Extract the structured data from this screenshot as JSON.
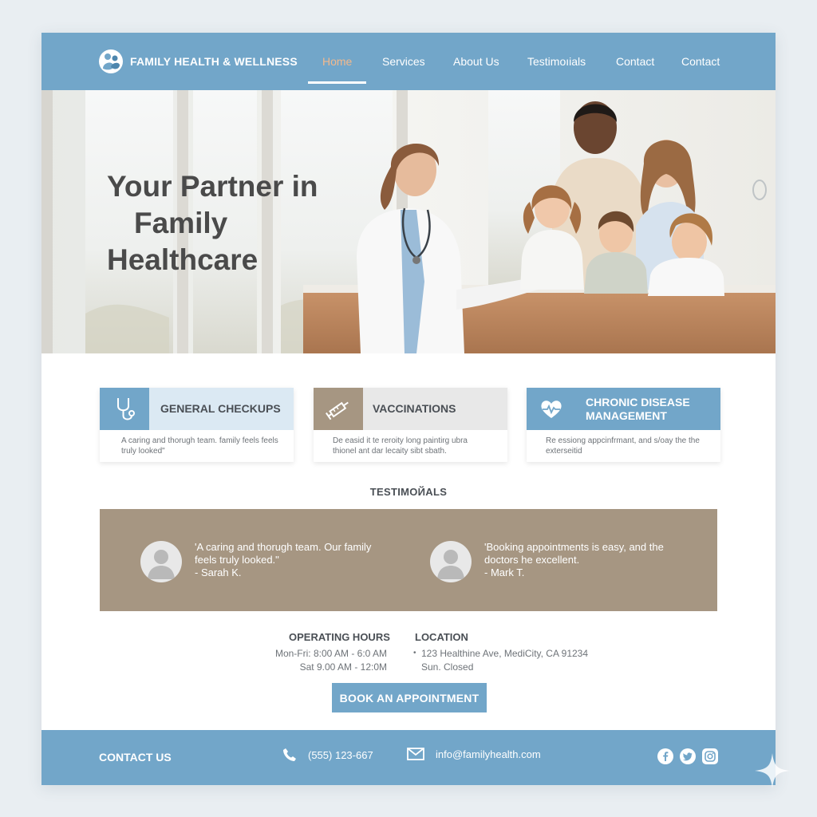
{
  "brand": {
    "name": "FAMILY HEALTH & WELLNESS",
    "logo": "family-care-logo"
  },
  "nav": {
    "items": [
      {
        "label": "Home",
        "active": true
      },
      {
        "label": "Services"
      },
      {
        "label": "About Us"
      },
      {
        "label": "Testimoıials"
      },
      {
        "label": "Contact"
      },
      {
        "label": "Contact"
      }
    ]
  },
  "hero": {
    "title_lines": [
      "Your Partner in",
      "Family",
      "Healthcare"
    ]
  },
  "services": [
    {
      "title_lines": [
        "GENERAL CHECKUPS"
      ],
      "icon": "stethoscope-icon",
      "desc": "A caring and thorugh team.  family feels feels truly looked\""
    },
    {
      "title_lines": [
        "VACCINATIONS"
      ],
      "icon": "syringe-icon",
      "desc": "De easid it te reroity long paintirg ubra thionel ant dar lecaity sibt sbath."
    },
    {
      "title_lines": [
        "CHRONIC DISEASE",
        "MANAGEMENT"
      ],
      "icon": "heart-pulse-icon",
      "desc": "Re essiong appcinfrmant, and s/oay the the exterseitid"
    }
  ],
  "testimonials": {
    "heading": "TESTIMOЙALS",
    "items": [
      {
        "quote": "'A caring and thorugh team. Our family feels truly looked.\"",
        "author": "- Sarah K."
      },
      {
        "quote": "'Booking appointments is easy, and the doctors he excellent.",
        "author": "- Mark T."
      }
    ]
  },
  "hours": {
    "title": "OPERATING HOURS",
    "lines": [
      "Mon-Fri: 8:00 AM - 6:0 AM",
      "Sat 9.00 AM - 12:0M"
    ]
  },
  "location": {
    "title": "LOCATION",
    "lines": [
      "123 Healthine Ave, MediCity, CA 91234",
      "Sun. Closed"
    ]
  },
  "cta": {
    "label": "BOOK AN APPOINTMENT"
  },
  "footer": {
    "title": "CONTACT US",
    "phone": "(555) 123-667",
    "email": "info@familyhealth.com",
    "social": [
      "facebook-icon",
      "twitter-icon",
      "instagram-icon"
    ]
  },
  "colors": {
    "primary": "#72a6c9",
    "accent_active": "#f3b98c",
    "testimonial_band": "#a69682",
    "card_head_light": "#dbe9f3",
    "card_head_gray": "#e8e8e8"
  }
}
